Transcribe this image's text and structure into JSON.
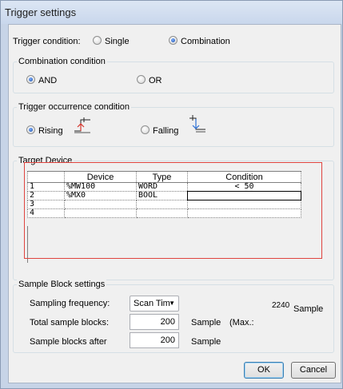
{
  "window": {
    "title": "Trigger settings"
  },
  "trigger_condition": {
    "label": "Trigger condition:",
    "options": [
      {
        "label": "Single",
        "selected": false
      },
      {
        "label": "Combination",
        "selected": true
      }
    ]
  },
  "combination_condition": {
    "legend": "Combination condition",
    "options": [
      {
        "label": "AND",
        "selected": true
      },
      {
        "label": "OR",
        "selected": false
      }
    ]
  },
  "trigger_occurrence": {
    "legend": "Trigger occurrence condition",
    "options": [
      {
        "label": "Rising",
        "selected": true,
        "icon": "rising-edge-icon"
      },
      {
        "label": "Falling",
        "selected": false,
        "icon": "falling-edge-icon"
      }
    ]
  },
  "target_device": {
    "legend": "Target Device",
    "columns": [
      "Device",
      "Type",
      "Condition"
    ],
    "rows": [
      {
        "num": "1",
        "device": "%MW100",
        "type": "WORD",
        "condition": "< 50"
      },
      {
        "num": "2",
        "device": "%MX0",
        "type": "BOOL",
        "condition": ""
      },
      {
        "num": "3",
        "device": "",
        "type": "",
        "condition": ""
      },
      {
        "num": "4",
        "device": "",
        "type": "",
        "condition": ""
      }
    ]
  },
  "sample_block": {
    "legend": "Sample Block settings",
    "sampling_frequency_label": "Sampling frequency:",
    "sampling_frequency_value": "Scan Tim",
    "total_blocks_label": "Total sample blocks:",
    "total_blocks_value": "200",
    "total_blocks_unit": "Sample",
    "max_label": "(Max.:",
    "max_value": "2240",
    "max_unit": "Sample",
    "blocks_after_label": "Sample blocks after",
    "blocks_after_value": "200",
    "blocks_after_unit": "Sample"
  },
  "buttons": {
    "ok": "OK",
    "cancel": "Cancel"
  },
  "colors": {
    "highlight_rect": "#e0443f",
    "titlebar": "#c9d7ec"
  }
}
